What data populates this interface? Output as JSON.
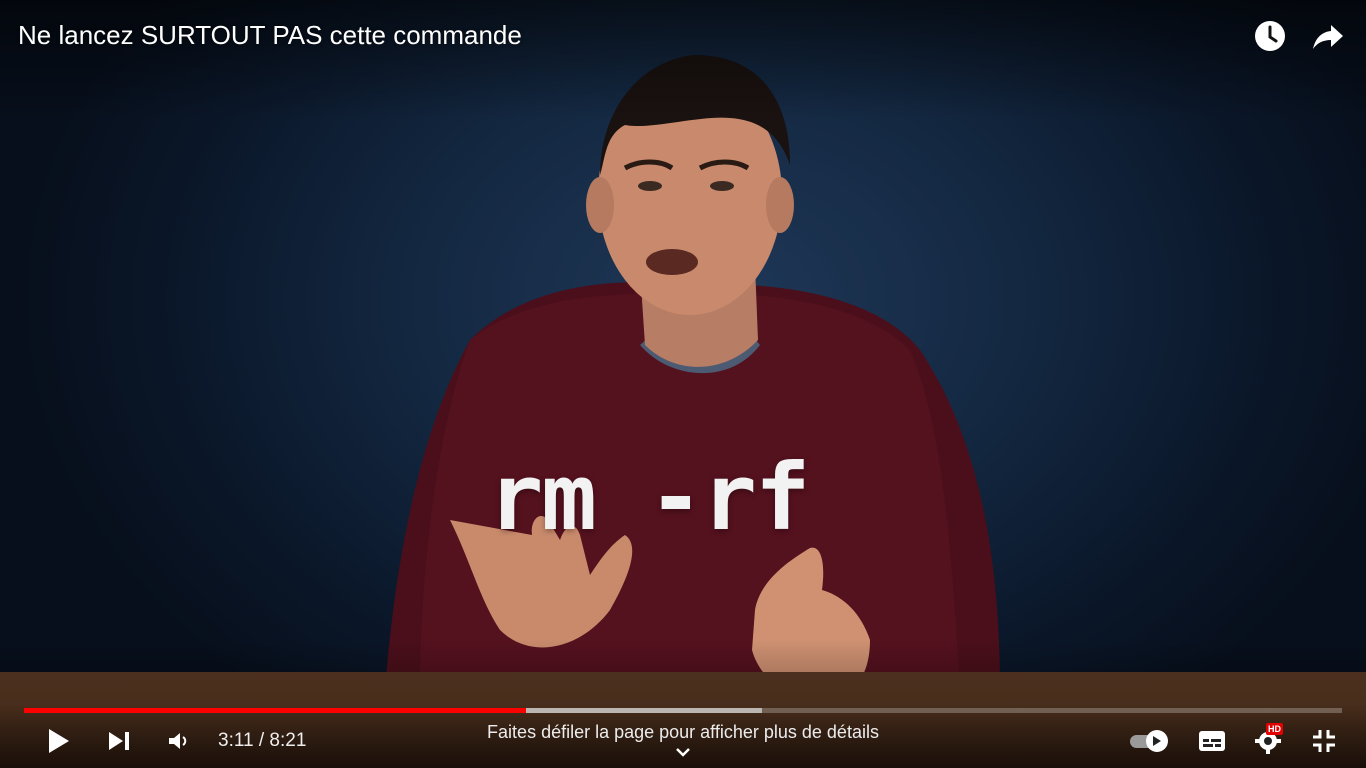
{
  "video": {
    "title": "Ne lancez SURTOUT PAS cette commande",
    "overlay_text": "rm -rf"
  },
  "top_icons": [
    "watch-later-icon",
    "share-icon"
  ],
  "player": {
    "current_time": "3:11",
    "duration": "8:21",
    "time_display": "3:11 / 8:21",
    "progress_fraction": 0.381,
    "buffered_fraction": 0.56,
    "scroll_hint": "Faites défiler la page pour afficher plus de détails",
    "hd_badge": "HD",
    "autoplay_on": true
  },
  "colors": {
    "progress_played": "#ff0000",
    "hd_badge": "#e20000"
  }
}
